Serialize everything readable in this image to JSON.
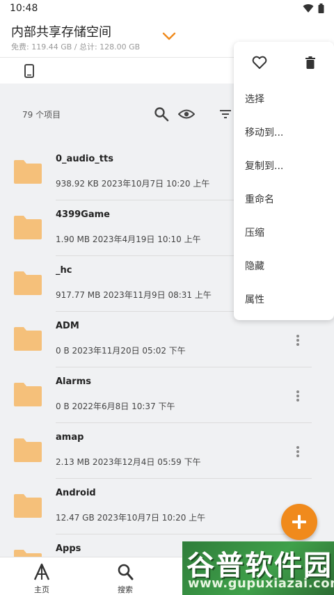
{
  "status_bar": {
    "time": "10:48"
  },
  "header": {
    "title": "内部共享存储空间",
    "subtitle": "免费: 119.44 GB / 总计: 128.00 GB"
  },
  "list_header": {
    "count_text": "79 个项目"
  },
  "files": [
    {
      "name": "0_audio_tts",
      "meta": "938.92 KB 2023年10月7日 10:20 上午"
    },
    {
      "name": "4399Game",
      "meta": "1.90 MB 2023年4月19日 10:10 上午"
    },
    {
      "name": "_hc",
      "meta": "917.77 MB 2023年11月9日 08:31 上午"
    },
    {
      "name": "ADM",
      "meta": "0 B 2023年11月20日 05:02 下午"
    },
    {
      "name": "Alarms",
      "meta": "0 B 2022年6月8日 10:37 下午"
    },
    {
      "name": "amap",
      "meta": "2.13 MB 2023年12月4日 05:59 下午"
    },
    {
      "name": "Android",
      "meta": "12.47 GB 2023年10月7日 10:20 上午"
    },
    {
      "name": "Apps",
      "meta": ""
    }
  ],
  "context_menu": {
    "items": [
      "选择",
      "移动到...",
      "复制到...",
      "重命名",
      "压缩",
      "隐藏",
      "属性"
    ]
  },
  "bottom_nav": {
    "home": "主页",
    "search": "搜索"
  },
  "watermark": {
    "cn": "谷普软件园",
    "en": "www.gupuxiazai.com"
  },
  "colors": {
    "accent": "#f08a1c",
    "folder": "#f5c07a"
  },
  "icons": [
    "heart-icon",
    "trash-icon",
    "search-icon",
    "eye-icon",
    "filter-icon",
    "phone-icon",
    "folder-icon",
    "more-vert-icon",
    "plus-icon",
    "home-icon",
    "chevron-down-icon"
  ]
}
